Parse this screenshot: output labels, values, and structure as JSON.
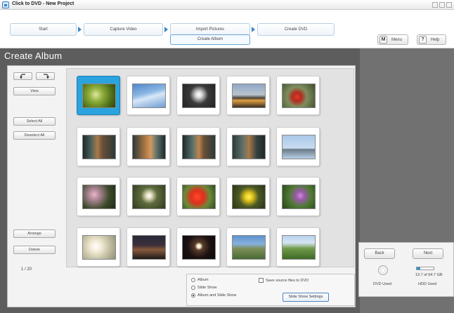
{
  "window": {
    "title": "Click to DVD - New Project"
  },
  "steps": [
    {
      "label": "Start"
    },
    {
      "label": "Capture Video"
    },
    {
      "label": "Import Pictures"
    },
    {
      "label": "Create DVD"
    }
  ],
  "sub_step": {
    "label": "Create Album"
  },
  "top_buttons": {
    "menu": {
      "key": "M",
      "label": "Menu"
    },
    "help": {
      "key": "?",
      "label": "Help"
    }
  },
  "page_title": "Create Album",
  "sidebar": {
    "view_label": "View",
    "select_all_label": "Select All",
    "deselect_all_label": "Deselect All",
    "arrange_label": "Arrange",
    "delete_label": "Delete",
    "counter": "1 / 20"
  },
  "thumbnails": [
    {
      "subject": "green foliage",
      "selected": true
    },
    {
      "subject": "blue sky clouds",
      "selected": false
    },
    {
      "subject": "white flowers",
      "selected": false
    },
    {
      "subject": "city skyline dusk",
      "selected": false
    },
    {
      "subject": "red flowers",
      "selected": false
    },
    {
      "subject": "cat in window",
      "selected": false
    },
    {
      "subject": "cat in window",
      "selected": false
    },
    {
      "subject": "cat in window",
      "selected": false
    },
    {
      "subject": "cat in window",
      "selected": false
    },
    {
      "subject": "bird on pole",
      "selected": false
    },
    {
      "subject": "pink flowers",
      "selected": false
    },
    {
      "subject": "white daisies",
      "selected": false
    },
    {
      "subject": "red spider lily",
      "selected": false
    },
    {
      "subject": "yellow flower",
      "selected": false
    },
    {
      "subject": "purple flowers",
      "selected": false
    },
    {
      "subject": "bright sky",
      "selected": false
    },
    {
      "subject": "dark sunset",
      "selected": false
    },
    {
      "subject": "night light",
      "selected": false
    },
    {
      "subject": "trees blue sky",
      "selected": false
    },
    {
      "subject": "green field",
      "selected": false
    }
  ],
  "options": {
    "album_label": "Album",
    "slide_show_label": "Slide Show",
    "album_and_slide_show_label": "Album and Slide Show",
    "selected_mode": "album_and_slide_show",
    "save_source_label": "Save source files to DVD",
    "save_source_checked": false,
    "slideshow_settings_label": "Slide Show Settings"
  },
  "navigation": {
    "back_label": "Back",
    "next_label": "Next",
    "dvd_used_label": "DVD Used",
    "hdd_used_label": "HDD Used",
    "hdd_value": "13.7 of 64.7 GB",
    "hdd_fraction": 0.21
  },
  "colors": {
    "accent": "#2aa3de",
    "arrow": "#3a87c9",
    "dark_bg": "#5d5d5d"
  }
}
